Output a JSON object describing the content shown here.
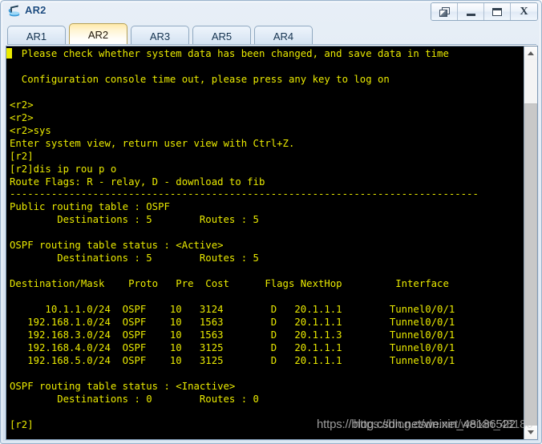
{
  "window": {
    "title": "AR2",
    "icon": "router-icon",
    "controls": [
      {
        "name": "cascade-windows-button",
        "label": "",
        "icon": "cascade-windows-icon"
      },
      {
        "name": "minimize-button",
        "label": "",
        "icon": "minimize-icon"
      },
      {
        "name": "maximize-button",
        "label": "",
        "icon": "maximize-icon"
      },
      {
        "name": "close-button",
        "label": "X",
        "icon": "close-icon"
      }
    ]
  },
  "tabs": [
    {
      "label": "AR1",
      "active": false
    },
    {
      "label": "AR2",
      "active": true
    },
    {
      "label": "AR3",
      "active": false
    },
    {
      "label": "AR5",
      "active": false
    },
    {
      "label": "AR4",
      "active": false
    }
  ],
  "terminal": {
    "background_color": "#000000",
    "text_color": "#eaea00",
    "content": "  Please check whether system data has been changed, and save data in time\n\n  Configuration console time out, please press any key to log on\n\n<r2>\n<r2>\n<r2>sys\nEnter system view, return user view with Ctrl+Z.\n[r2]\n[r2]dis ip rou p o\nRoute Flags: R - relay, D - download to fib\n-------------------------------------------------------------------------------\nPublic routing table : OSPF\n        Destinations : 5        Routes : 5\n\nOSPF routing table status : <Active>\n        Destinations : 5        Routes : 5\n\nDestination/Mask    Proto   Pre  Cost      Flags NextHop         Interface\n\n      10.1.1.0/24  OSPF    10   3124        D   20.1.1.1        Tunnel0/0/1\n   192.168.1.0/24  OSPF    10   1563        D   20.1.1.1        Tunnel0/0/1\n   192.168.3.0/24  OSPF    10   1563        D   20.1.1.3        Tunnel0/0/1\n   192.168.4.0/24  OSPF    10   3125        D   20.1.1.1        Tunnel0/0/1\n   192.168.5.0/24  OSPF    10   3125        D   20.1.1.1        Tunnel0/0/1\n\nOSPF routing table status : <Inactive>\n        Destinations : 0        Routes : 0\n\n[r2]",
    "prompt": "[r2]",
    "commands": [
      "sys",
      "dis ip rou p o"
    ],
    "messages": [
      "  Please check whether system data has been changed, and save data in time",
      "  Configuration console time out, please press any key to log on",
      "Enter system view, return user view with Ctrl+Z.",
      "Route Flags: R - relay, D - download to fib"
    ],
    "route_table": {
      "public_routing_table": "OSPF",
      "public_destinations": "5",
      "public_routes": "5",
      "active_status": "<Active>",
      "active_destinations": "5",
      "active_routes": "5",
      "inactive_status": "<Inactive>",
      "inactive_destinations": "0",
      "inactive_routes": "0",
      "columns": [
        "Destination/Mask",
        "Proto",
        "Pre",
        "Cost",
        "Flags",
        "NextHop",
        "Interface"
      ],
      "rows": [
        {
          "destination": "10.1.1.0/24",
          "proto": "OSPF",
          "pre": "10",
          "cost": "3124",
          "flags": "D",
          "nexthop": "20.1.1.1",
          "interface": "Tunnel0/0/1"
        },
        {
          "destination": "192.168.1.0/24",
          "proto": "OSPF",
          "pre": "10",
          "cost": "1563",
          "flags": "D",
          "nexthop": "20.1.1.1",
          "interface": "Tunnel0/0/1"
        },
        {
          "destination": "192.168.3.0/24",
          "proto": "OSPF",
          "pre": "10",
          "cost": "1563",
          "flags": "D",
          "nexthop": "20.1.1.3",
          "interface": "Tunnel0/0/1"
        },
        {
          "destination": "192.168.4.0/24",
          "proto": "OSPF",
          "pre": "10",
          "cost": "3125",
          "flags": "D",
          "nexthop": "20.1.1.1",
          "interface": "Tunnel0/0/1"
        },
        {
          "destination": "192.168.5.0/24",
          "proto": "OSPF",
          "pre": "10",
          "cost": "3125",
          "flags": "D",
          "nexthop": "20.1.1.1",
          "interface": "Tunnel0/0/1"
        }
      ]
    }
  },
  "scrollbar": {
    "up_arrow": "▲",
    "down_arrow": "▼"
  },
  "watermark": {
    "line_a": "https://blog.csdn.net/weixin_48186522",
    "line_b": "https://blog.csdn.net/weixin_48186522"
  }
}
